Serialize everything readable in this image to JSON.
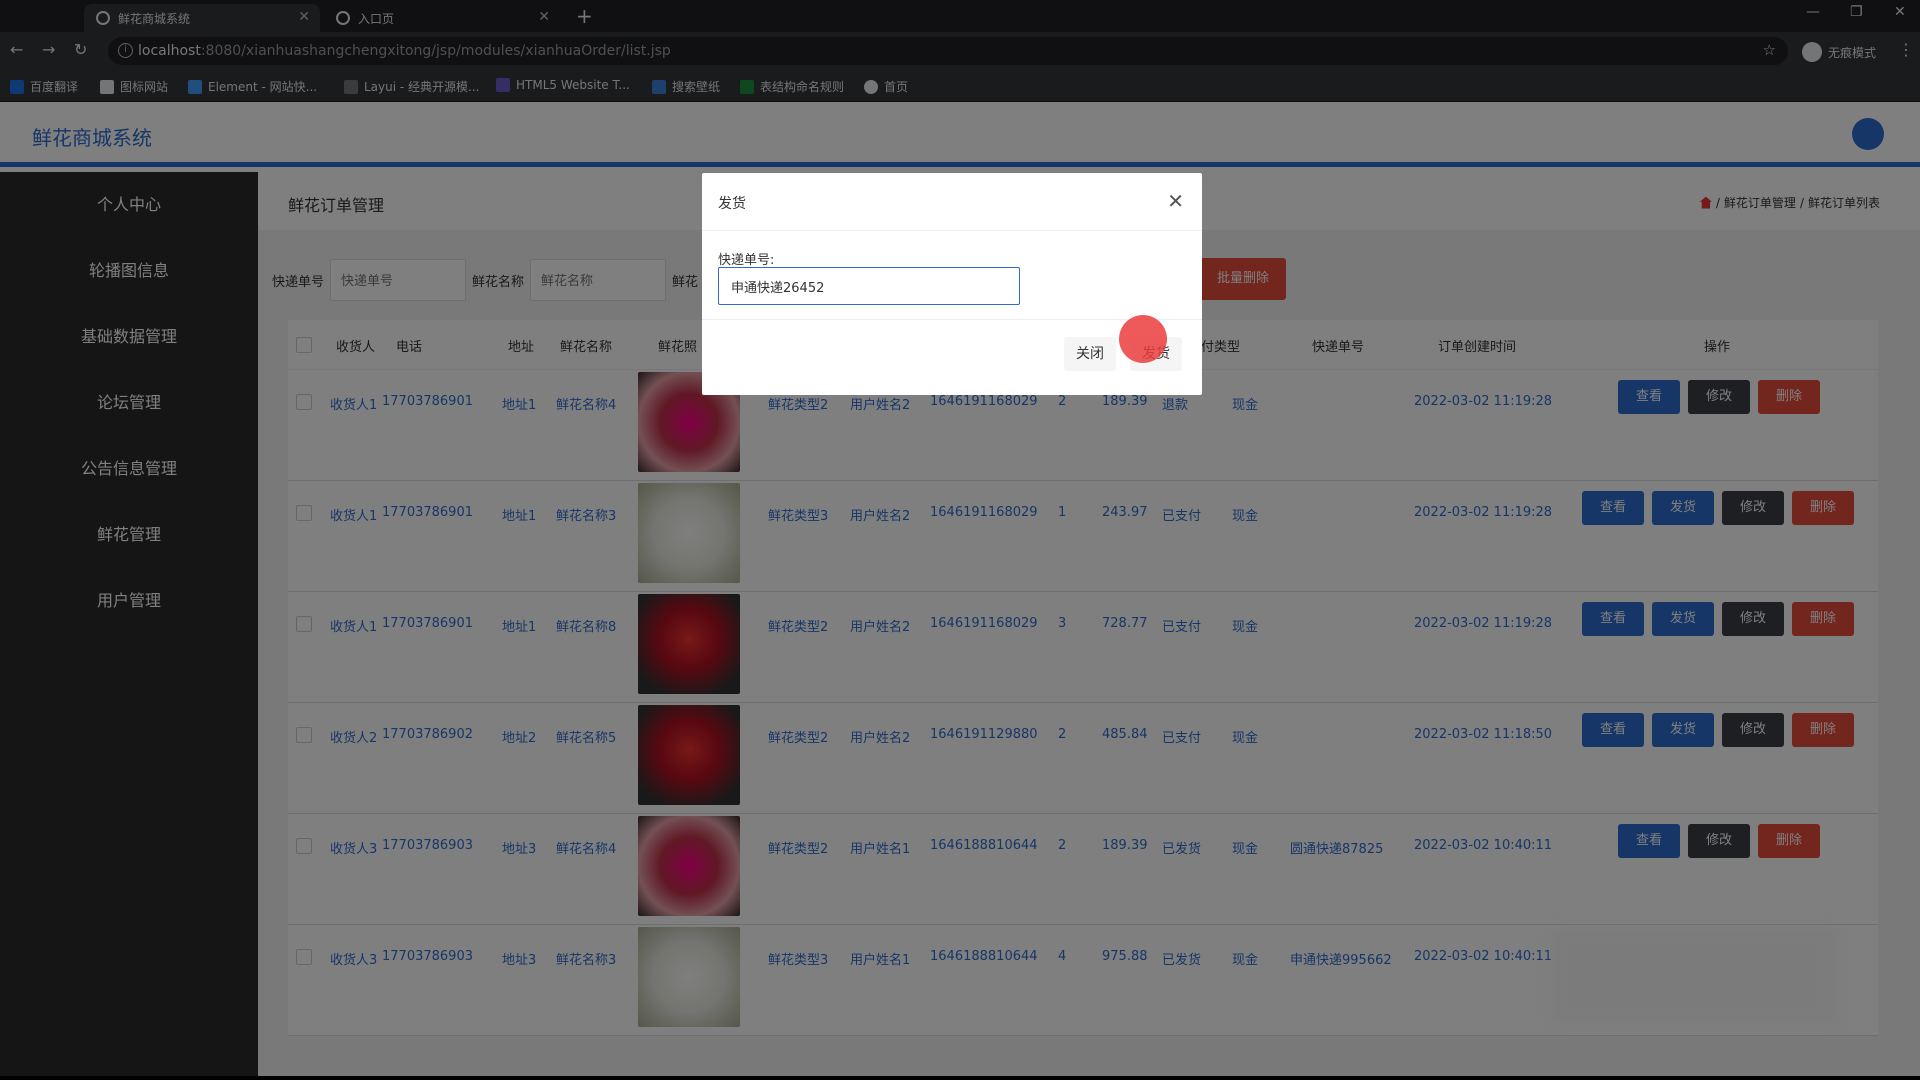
{
  "browser": {
    "tabs": [
      {
        "title": "鲜花商城系统",
        "active": true
      },
      {
        "title": "入口页",
        "active": false
      }
    ],
    "address": {
      "host": "localhost",
      "path": ":8080/xianhuashangchengxitong/jsp/modules/xianhuaOrder/list.jsp"
    },
    "incognito_label": "无痕模式",
    "bookmarks": [
      "百度翻译",
      "图标网站",
      "Element - 网站快...",
      "Layui - 经典开源模...",
      "HTML5 Website T...",
      "搜索壁纸",
      "表结构命名规则",
      "首页"
    ]
  },
  "header": {
    "brand": "鲜花商城系统"
  },
  "sidebar": {
    "items": [
      "个人中心",
      "轮播图信息",
      "基础数据管理",
      "论坛管理",
      "公告信息管理",
      "鲜花管理",
      "用户管理"
    ]
  },
  "main": {
    "page_title": "鲜花订单管理",
    "breadcrumb": [
      "鲜花订单管理",
      "鲜花订单列表"
    ],
    "search": {
      "fields": [
        {
          "label": "快递单号",
          "placeholder": "快递单号"
        },
        {
          "label": "鲜花名称",
          "placeholder": "鲜花名称"
        }
      ],
      "truncated_label": "鲜花",
      "batch_delete": "批量删除"
    },
    "table": {
      "headers": [
        "收货人",
        "电话",
        "地址",
        "鲜花名称",
        "鲜花照",
        "型",
        "支付类型",
        "快递单号",
        "订单创建时间",
        "操作"
      ],
      "rows": [
        {
          "receiver": "收货人1",
          "phone": "17703786901",
          "address": "地址1",
          "flower": "鲜花名称4",
          "type": "鲜花类型2",
          "user": "用户姓名2",
          "order_no": "1646191168029",
          "qty": "2",
          "price": "189.39",
          "status": "退款",
          "pay": "现金",
          "express": "",
          "created": "2022-03-02 11:19:28",
          "actions": [
            "查看",
            "修改",
            "删除"
          ]
        },
        {
          "receiver": "收货人1",
          "phone": "17703786901",
          "address": "地址1",
          "flower": "鲜花名称3",
          "type": "鲜花类型3",
          "user": "用户姓名2",
          "order_no": "1646191168029",
          "qty": "1",
          "price": "243.97",
          "status": "已支付",
          "pay": "现金",
          "express": "",
          "created": "2022-03-02 11:19:28",
          "actions": [
            "查看",
            "发货",
            "修改",
            "删除"
          ]
        },
        {
          "receiver": "收货人1",
          "phone": "17703786901",
          "address": "地址1",
          "flower": "鲜花名称8",
          "type": "鲜花类型2",
          "user": "用户姓名2",
          "order_no": "1646191168029",
          "qty": "3",
          "price": "728.77",
          "status": "已支付",
          "pay": "现金",
          "express": "",
          "created": "2022-03-02 11:19:28",
          "actions": [
            "查看",
            "发货",
            "修改",
            "删除"
          ]
        },
        {
          "receiver": "收货人2",
          "phone": "17703786902",
          "address": "地址2",
          "flower": "鲜花名称5",
          "type": "鲜花类型2",
          "user": "用户姓名2",
          "order_no": "1646191129880",
          "qty": "2",
          "price": "485.84",
          "status": "已支付",
          "pay": "现金",
          "express": "",
          "created": "2022-03-02 11:18:50",
          "actions": [
            "查看",
            "发货",
            "修改",
            "删除"
          ]
        },
        {
          "receiver": "收货人3",
          "phone": "17703786903",
          "address": "地址3",
          "flower": "鲜花名称4",
          "type": "鲜花类型2",
          "user": "用户姓名1",
          "order_no": "1646188810644",
          "qty": "2",
          "price": "189.39",
          "status": "已发货",
          "pay": "现金",
          "express": "圆通快递87825",
          "created": "2022-03-02 10:40:11",
          "actions": [
            "查看",
            "修改",
            "删除"
          ]
        },
        {
          "receiver": "收货人3",
          "phone": "17703786903",
          "address": "地址3",
          "flower": "鲜花名称3",
          "type": "鲜花类型3",
          "user": "用户姓名1",
          "order_no": "1646188810644",
          "qty": "4",
          "price": "975.88",
          "status": "已发货",
          "pay": "现金",
          "express": "申通快递995662",
          "created": "2022-03-02 10:40:11",
          "actions": []
        }
      ]
    }
  },
  "modal": {
    "title": "发货",
    "field_label": "快递单号:",
    "field_value": "申通快递26452",
    "close_label": "关闭",
    "confirm_label": "发货"
  },
  "colors": {
    "primary": "#2d6ccf",
    "danger": "#e74c3c",
    "dark": "#3c3f44"
  }
}
